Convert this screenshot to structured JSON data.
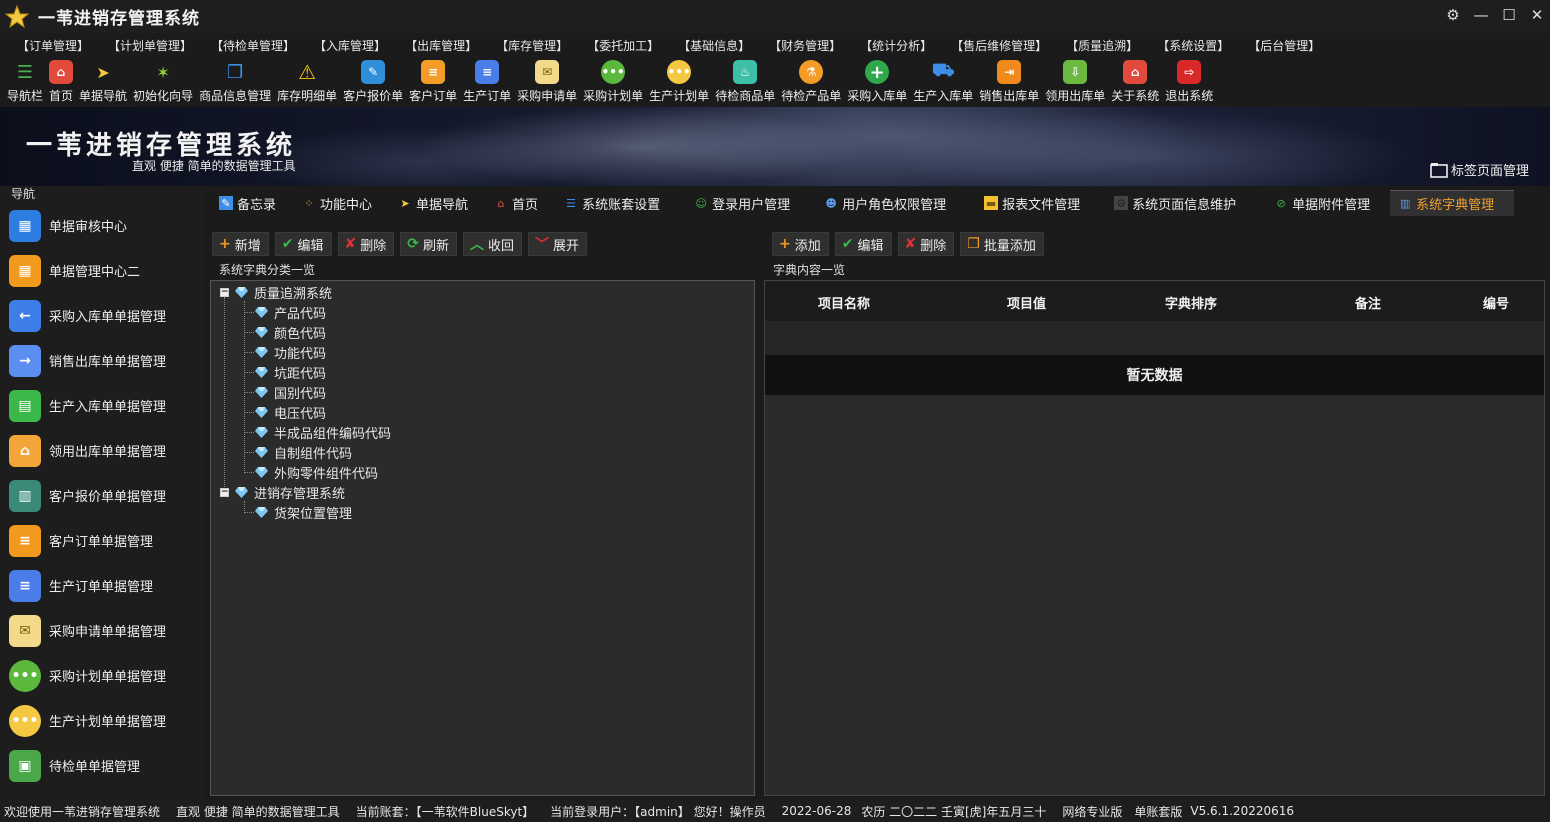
{
  "window": {
    "title": "一苇进销存管理系统"
  },
  "menu": [
    "【订单管理】",
    "【计划单管理】",
    "【待检单管理】",
    "【入库管理】",
    "【出库管理】",
    "【库存管理】",
    "【委托加工】",
    "【基础信息】",
    "【财务管理】",
    "【统计分析】",
    "【售后维修管理】",
    "【质量追溯】",
    "【系统设置】",
    "【后台管理】"
  ],
  "toolbar": [
    "导航栏",
    "首页",
    "单据导航",
    "初始化向导",
    "商品信息管理",
    "库存明细单",
    "客户报价单",
    "客户订单",
    "生产订单",
    "采购申请单",
    "采购计划单",
    "生产计划单",
    "待检商品单",
    "待检产品单",
    "采购入库单",
    "生产入库单",
    "销售出库单",
    "领用出库单",
    "关于系统",
    "退出系统"
  ],
  "banner": {
    "title": "一苇进销存管理系统",
    "subtitle": "直观 便捷 简单的数据管理工具",
    "tag_manager": "标签页面管理"
  },
  "sidebar": {
    "head": "导航",
    "items": [
      "单据审核中心",
      "单据管理中心二",
      "采购入库单单据管理",
      "销售出库单单据管理",
      "生产入库单单据管理",
      "领用出库单单据管理",
      "客户报价单单据管理",
      "客户订单单据管理",
      "生产订单单据管理",
      "采购申请单单据管理",
      "采购计划单单据管理",
      "生产计划单单据管理",
      "待检单单据管理"
    ]
  },
  "tabs": [
    "备忘录",
    "功能中心",
    "单据导航",
    "首页",
    "系统账套设置",
    "登录用户管理",
    "用户角色权限管理",
    "报表文件管理",
    "系统页面信息维护",
    "单据附件管理",
    "系统字典管理"
  ],
  "left_panel": {
    "buttons": [
      "新增",
      "编辑",
      "删除",
      "刷新",
      "收回",
      "展开"
    ],
    "group_title": "系统字典分类一览",
    "tree": [
      {
        "label": "质量追溯系统",
        "children": [
          "产品代码",
          "颜色代码",
          "功能代码",
          "坑距代码",
          "国别代码",
          "电压代码",
          "半成品组件编码代码",
          "自制组件代码",
          "外购零件组件代码"
        ]
      },
      {
        "label": "进销存管理系统",
        "children": [
          "货架位置管理"
        ]
      }
    ]
  },
  "right_panel": {
    "buttons": [
      "添加",
      "编辑",
      "删除",
      "批量添加"
    ],
    "group_title": "字典内容一览",
    "columns": [
      "项目名称",
      "项目值",
      "字典排序",
      "备注",
      "编号"
    ],
    "empty_text": "暂无数据"
  },
  "status": [
    "欢迎使用一苇进销存管理系统",
    "直观 便捷 简单的数据管理工具",
    "当前账套：【一苇软件BlueSkyt】",
    "当前登录用户：【admin】 您好！操作员",
    "2022-06-28",
    "农历 二〇二二 壬寅[虎]年五月三十",
    "网络专业版",
    "单账套版",
    "V5.6.1.20220616"
  ],
  "colors": {
    "accent": "#f0a030",
    "background": "#1b1b1b"
  }
}
